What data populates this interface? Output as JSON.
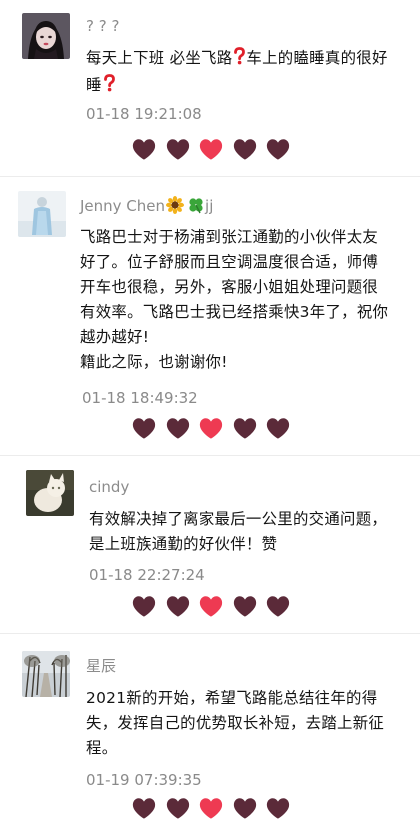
{
  "colors": {
    "heart_dark": "#5b2a39",
    "heart_red": "#ee3a52",
    "name": "#8c8c8c",
    "text": "#141414",
    "time": "#8a8a8a"
  },
  "comments": [
    {
      "name": "? ? ?",
      "name_badges": [],
      "avatar": "avatar-girl-dark-hair",
      "lines": [
        "每天上下班 必坐飞路",
        "车上的瞌睡真的很好",
        "睡"
      ],
      "inline_icons": [
        "red-question-mark-icon",
        "red-question-mark-icon"
      ],
      "time": "01-18 19:21:08",
      "hearts": [
        "heart-dark",
        "heart-dark",
        "heart-red",
        "heart-dark",
        "heart-dark"
      ]
    },
    {
      "name": "Jenny Chen",
      "name_badges": [
        "sunflower-icon",
        "four-leaf-clover-icon"
      ],
      "name_suffix": "jj",
      "avatar": "avatar-figure-light-blue",
      "lines": [
        "飞路巴士对于杨浦到张江通勤的小伙伴太友",
        "好了。位子舒服而且空调温度很合适，师傅",
        "开车也很稳，另外，客服小姐姐处理问题很",
        "有效率。飞路巴士我已经搭乘快3年了，祝你",
        "越办越好!",
        "籍此之际，也谢谢你!"
      ],
      "time": "01-18 18:49:32",
      "hearts": [
        "heart-dark",
        "heart-dark",
        "heart-red",
        "heart-dark",
        "heart-dark"
      ]
    },
    {
      "name": "cindy",
      "name_badges": [],
      "avatar": "avatar-white-cat",
      "lines": [
        "有效解决掉了离家最后一公里的交通问题，",
        "是上班族通勤的好伙伴！赞"
      ],
      "time": "01-18 22:27:24",
      "hearts": [
        "heart-dark",
        "heart-dark",
        "heart-red",
        "heart-dark",
        "heart-dark"
      ]
    },
    {
      "name": "星辰",
      "name_badges": [],
      "avatar": "avatar-tree-lined-road",
      "lines": [
        "2021新的开始，希望飞路能总结往年的得",
        "失，发挥自己的优势取长补短，去踏上新征",
        "程。"
      ],
      "time": "01-19 07:39:35",
      "hearts": [
        "heart-dark",
        "heart-dark",
        "heart-red",
        "heart-dark",
        "heart-dark"
      ]
    }
  ]
}
